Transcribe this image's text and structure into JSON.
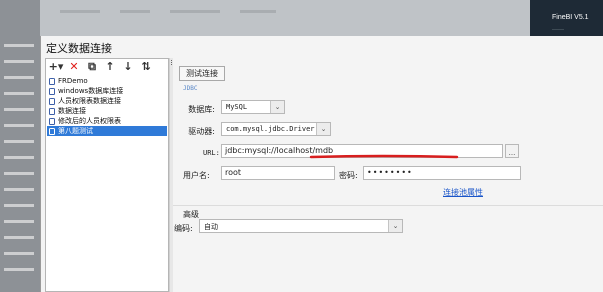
{
  "dialog": {
    "title": "定义数据连接"
  },
  "background": {
    "brand": "FineBI V5.1"
  },
  "toolbar": {
    "buttons": [
      {
        "name": "add-button",
        "glyph": "+▾"
      },
      {
        "name": "delete-button",
        "glyph": "✕"
      },
      {
        "name": "copy-button",
        "glyph": "⧉"
      },
      {
        "name": "move-up-button",
        "glyph": "↑"
      },
      {
        "name": "move-down-button",
        "glyph": "↓"
      },
      {
        "name": "sort-button",
        "glyph": "⇅"
      }
    ]
  },
  "connections": [
    {
      "label": "FRDemo",
      "selected": false
    },
    {
      "label": "windows数据库连接",
      "selected": false
    },
    {
      "label": "人员权限表数据连接",
      "selected": false
    },
    {
      "label": "数据连接",
      "selected": false
    },
    {
      "label": "修改后的人员权限表",
      "selected": false
    },
    {
      "label": "第八题测试",
      "selected": true
    }
  ],
  "form": {
    "test_button": "测试连接",
    "section_jdbc": "JDBC",
    "db_label": "数据库:",
    "db_value": "MySQL",
    "driver_label": "驱动器:",
    "driver_value": "com.mysql.jdbc.Driver",
    "url_label": "URL:",
    "url_value": "jdbc:mysql://localhost/mdb",
    "url_more": "...",
    "user_label": "用户名:",
    "user_value": "root",
    "password_label": "密码:",
    "password_value": "••••••••",
    "pool_link": "连接池属性",
    "advanced_label": "高级",
    "encoding_label": "编码:",
    "encoding_value": "自动"
  },
  "colors": {
    "selection": "#2f7ad8",
    "link": "#1a55c9",
    "annotation": "#d81e1e",
    "delete": "#e0201c"
  }
}
